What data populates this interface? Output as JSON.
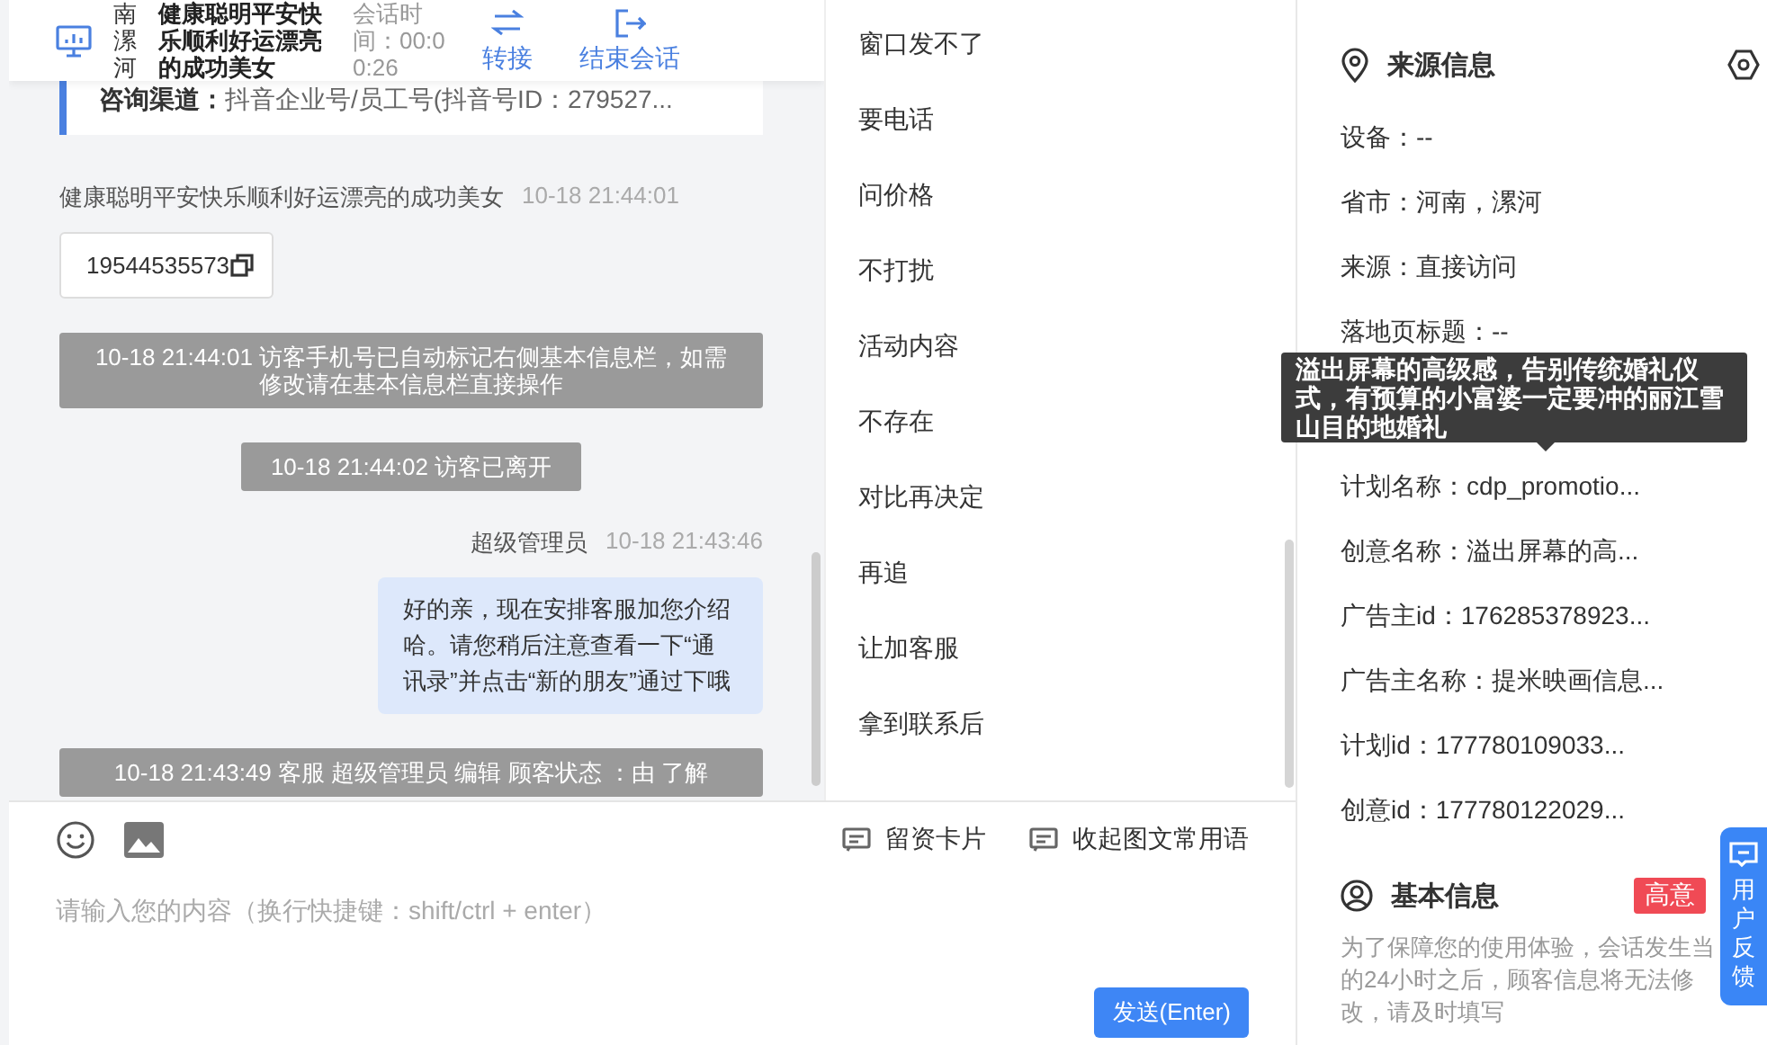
{
  "header": {
    "location": "南漯河",
    "visitor_name": "健康聪明平安快乐顺利好运漂亮的成功美女",
    "session_time": "会话时间：00:00:26",
    "actions": [
      {
        "label": "转接",
        "kind": "transfer"
      },
      {
        "label": "结束会话",
        "kind": "end"
      }
    ]
  },
  "chat": {
    "channel": "**咨询渠道：**抖音企业号/员工号(抖音号ID：279527...",
    "messages": [
      {
        "kind": "visitor",
        "sender": "健康聪明平安快乐顺利好运漂亮的成功美女",
        "time": "10-18 21:44:01",
        "text": "19544535573"
      },
      {
        "kind": "system",
        "text": "10-18 21:44:01 访客手机号已自动标记右侧基本信息栏，如需修改请在基本信息栏直接操作"
      },
      {
        "kind": "system",
        "text": "10-18 21:44:02 访客已离开"
      },
      {
        "kind": "agent",
        "sender": "超级管理员",
        "time": "10-18 21:43:46",
        "text": "好的亲，现在安排客服加您介绍哈。请您稍后注意查看一下“通讯录”并点击“新的朋友”通过下哦"
      },
      {
        "kind": "system",
        "text": "10-18 21:43:49 客服 超级管理员 编辑 顾客状态 ：由 了解"
      }
    ]
  },
  "quick_replies": [
    "窗口发不了",
    "要电话",
    "问价格",
    "不打扰",
    "活动内容",
    "不存在",
    "对比再决定",
    "再追",
    "让加客服",
    "拿到联系后"
  ],
  "input": {
    "links": [
      {
        "label": "留资卡片"
      },
      {
        "label": "收起图文常用语"
      }
    ],
    "placeholder": "请输入您的内容（换行快捷键：shift/ctrl + enter）",
    "send": "发送(Enter)"
  },
  "source_info": {
    "title": "来源信息",
    "rows": [
      "设备：--",
      "省市：河南，漯河",
      "来源：直接访问",
      "落地页标题：--",
      "计划名称：cdp_promotio...",
      "创意名称：溢出屏幕的高...",
      "广告主id：176285378923...",
      "广告主名称：提米映画信息...",
      "计划id：177780109033...",
      "创意id：177780122029..."
    ]
  },
  "tooltip": "溢出屏幕的高级感，告别传统婚礼仪式，有预算的小富婆一定要冲的丽江雪山目的地婚礼",
  "basic_info": {
    "title": "基本信息",
    "tag": "高意",
    "note": "为了保障您的使用体验，会话发生当的24小时之后，顾客信息将无法修改，请及时填写"
  },
  "feedback": "用户反馈"
}
